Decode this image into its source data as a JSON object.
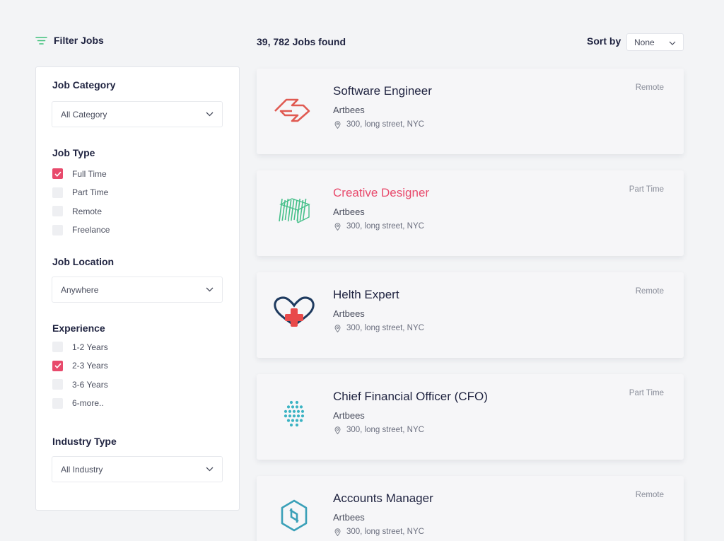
{
  "filter": {
    "title": "Filter Jobs"
  },
  "sections": {
    "job_category": {
      "title": "Job Category",
      "select_value": "All Category"
    },
    "job_type": {
      "title": "Job Type",
      "options": [
        {
          "label": "Full Time",
          "checked": true
        },
        {
          "label": "Part Time",
          "checked": false
        },
        {
          "label": "Remote",
          "checked": false
        },
        {
          "label": "Freelance",
          "checked": false
        }
      ]
    },
    "job_location": {
      "title": "Job Location",
      "select_value": "Anywhere"
    },
    "experience": {
      "title": "Experience",
      "options": [
        {
          "label": "1-2 Years",
          "checked": false
        },
        {
          "label": "2-3 Years",
          "checked": true
        },
        {
          "label": "3-6 Years",
          "checked": false
        },
        {
          "label": "6-more..",
          "checked": false
        }
      ]
    },
    "industry_type": {
      "title": "Industry Type",
      "select_value": "All Industry"
    }
  },
  "results": {
    "count_text": "39, 782 Jobs found"
  },
  "sort": {
    "label": "Sort by",
    "value": "None"
  },
  "jobs": [
    {
      "title": "Software Engineer",
      "company": "Artbees",
      "location": "300, long street, NYC",
      "type": "Remote",
      "highlight": false,
      "logo": "chevron-logo"
    },
    {
      "title": "Creative Designer",
      "company": "Artbees",
      "location": "300, long street, NYC",
      "type": "Part Time",
      "highlight": true,
      "logo": "hatched-cube-logo"
    },
    {
      "title": "Helth Expert",
      "company": "Artbees",
      "location": "300, long street, NYC",
      "type": "Remote",
      "highlight": false,
      "logo": "heart-cross-logo"
    },
    {
      "title": "Chief Financial Officer (CFO)",
      "company": "Artbees",
      "location": "300, long street, NYC",
      "type": "Part Time",
      "highlight": false,
      "logo": "dots-hexagon-logo"
    },
    {
      "title": "Accounts Manager",
      "company": "Artbees",
      "location": "300, long street, NYC",
      "type": "Remote",
      "highlight": false,
      "logo": "hexagon-link-logo"
    }
  ],
  "colors": {
    "accent": "#e84a6c",
    "filter_icon": "#3ec07a",
    "text_dark": "#1f2340"
  }
}
